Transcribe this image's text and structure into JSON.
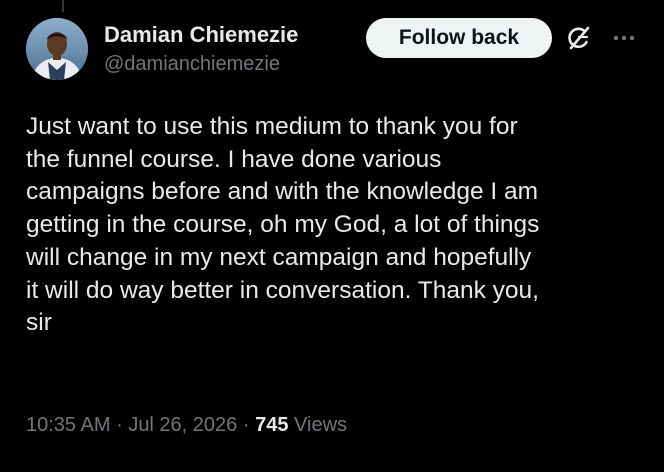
{
  "tweet": {
    "author": {
      "display_name": "Damian Chiemezie",
      "handle": "@damianchiemezie",
      "avatar_icon": "avatar-photo"
    },
    "follow_button_label": "Follow back",
    "actions": {
      "grok_icon": "grok-icon",
      "more_icon": "more-icon"
    },
    "text": "Just want to use this medium to thank you for\nthe funnel course. I have done various\ncampaigns before and with the knowledge I am\ngetting in the course, oh my God, a lot of things\nwill change in my next campaign and hopefully\nit will do way better in conversation. Thank you,\nsir",
    "time": "10:35 AM",
    "separator": "·",
    "date": "Jul 26, 2026",
    "views_count": "745",
    "views_label": "Views"
  },
  "colors": {
    "background": "#000000",
    "primary_text": "#e7e9ea",
    "secondary_text": "#71767b",
    "button_bg": "#eff3f4",
    "button_text": "#0f1419"
  }
}
